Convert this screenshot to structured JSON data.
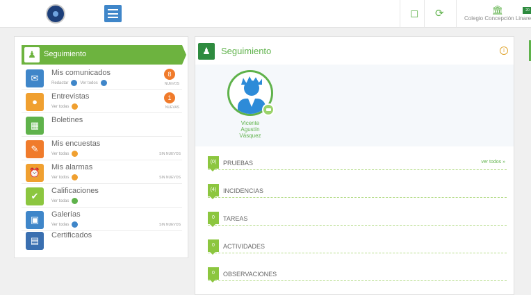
{
  "topbar": {
    "school_name": "Colegio Concepción Linares",
    "tab_label": "20"
  },
  "sidebar": {
    "header_label": "Seguimiento",
    "items": [
      {
        "title": "Mis comunicados",
        "sub_a": "Redactar",
        "sub_b": "Ver todos",
        "badge": "8",
        "badge_note": "NUEVOS"
      },
      {
        "title": "Entrevistas",
        "sub_a": "Ver todas",
        "badge": "1",
        "badge_note": "NUEVAS"
      },
      {
        "title": "Boletines"
      },
      {
        "title": "Mis encuestas",
        "sub_a": "Ver todas",
        "note": "SIN NUEVOS"
      },
      {
        "title": "Mis alarmas",
        "sub_a": "Ver todos",
        "note": "SIN NUEVOS"
      },
      {
        "title": "Calificaciones",
        "sub_a": "Ver todas"
      },
      {
        "title": "Galerías",
        "sub_a": "Ver todas",
        "note": "SIN NUEVOS"
      },
      {
        "title": "Certificados"
      }
    ]
  },
  "main": {
    "title": "Seguimiento",
    "student": {
      "line1": "Vicente",
      "line2": "Agustín",
      "line3": "Vásquez"
    },
    "sections": [
      {
        "count": "(0)",
        "label": "PRUEBAS",
        "link": "ver todos »"
      },
      {
        "count": "(4)",
        "label": "INCIDENCIAS"
      },
      {
        "count": "0",
        "label": "TAREAS"
      },
      {
        "count": "0",
        "label": "ACTIVIDADES"
      },
      {
        "count": "0",
        "label": "OBSERVACIONES"
      }
    ]
  },
  "icons": {
    "logo": "school-crest",
    "menu": "hamburger-menu",
    "clipboard": "clipboard",
    "history": "history-clock",
    "building": "school-building",
    "info": "info-circle",
    "accent_green": "#6db33f",
    "accent_blue": "#3f86c9",
    "accent_orange": "#f07b2b"
  }
}
